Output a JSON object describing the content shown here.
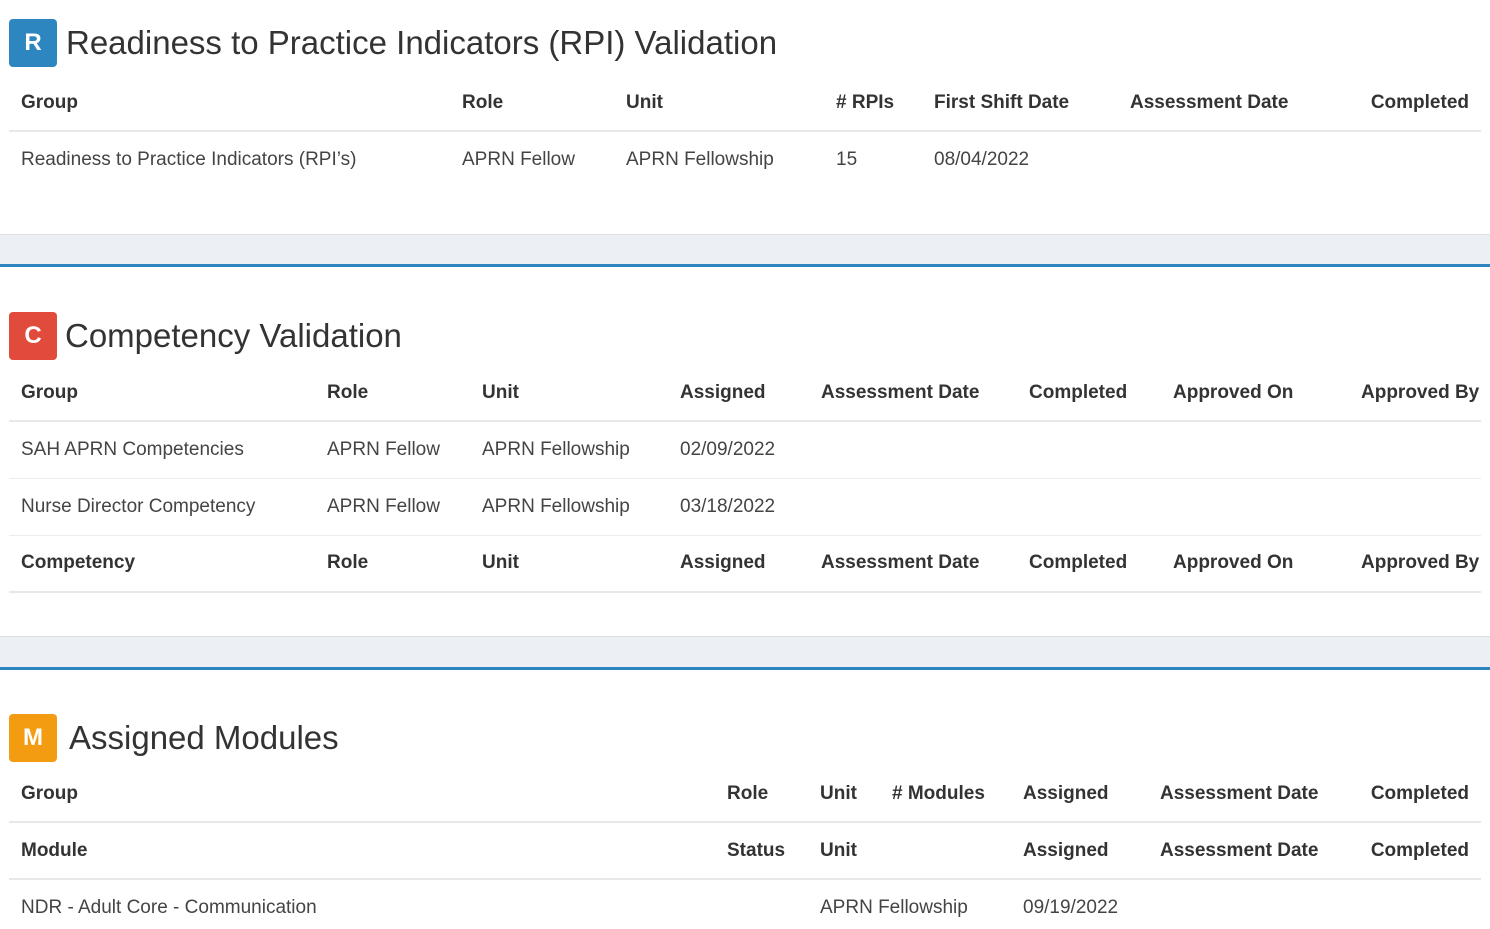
{
  "rpi": {
    "badge": "R",
    "title": "Readiness to Practice Indicators (RPI) Validation",
    "columns": [
      "Group",
      "Role",
      "Unit",
      "# RPIs",
      "First Shift Date",
      "Assessment Date",
      "Completed"
    ],
    "rows": [
      [
        "Readiness to Practice Indicators (RPI’s)",
        "APRN Fellow",
        "APRN Fellowship",
        "15",
        "08/04/2022",
        "",
        ""
      ]
    ]
  },
  "competency": {
    "badge": "C",
    "title": "Competency Validation",
    "columns": [
      "Group",
      "Role",
      "Unit",
      "Assigned",
      "Assessment Date",
      "Completed",
      "Approved On",
      "Approved By"
    ],
    "rows": [
      [
        "SAH APRN Competencies",
        "APRN Fellow",
        "APRN Fellowship",
        "02/09/2022",
        "",
        "",
        "",
        ""
      ],
      [
        "Nurse Director Competency",
        "APRN Fellow",
        "APRN Fellowship",
        "03/18/2022",
        "",
        "",
        "",
        ""
      ]
    ],
    "sub_columns": [
      "Competency",
      "Role",
      "Unit",
      "Assigned",
      "Assessment Date",
      "Completed",
      "Approved On",
      "Approved By"
    ]
  },
  "modules": {
    "badge": "M",
    "title": "Assigned Modules",
    "columns": [
      "Group",
      "Role",
      "Unit",
      "# Modules",
      "Assigned",
      "Assessment Date",
      "Completed"
    ],
    "sub_columns": [
      "Module",
      "Status",
      "Unit",
      "",
      "Assigned",
      "Assessment Date",
      "Completed"
    ],
    "rows": [
      [
        "NDR - Adult Core - Communication",
        "",
        "APRN Fellowship",
        "",
        "09/19/2022",
        "",
        ""
      ]
    ]
  },
  "colors": {
    "rpi_badge": "#2e86c1",
    "competency_badge": "#e04b3c",
    "modules_badge": "#f39c12",
    "divider": "#2e86c1"
  }
}
